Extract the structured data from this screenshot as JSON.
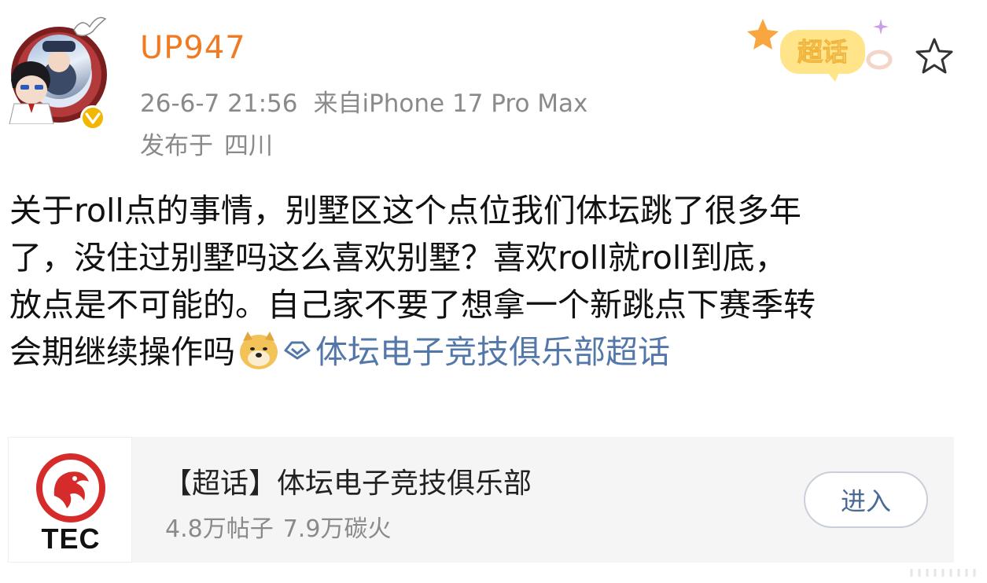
{
  "post": {
    "username": "UP947",
    "timestamp": "26-6-7 21:56",
    "source": "来自iPhone 17 Pro Max",
    "location_prefix": "发布于",
    "location": "四川",
    "chaohua_badge": "超话",
    "content_lines": [
      "关于roll点的事情，别墅区这个点位我们体坛跳了很多年",
      "了，没住过别墅吗这么喜欢别墅？喜欢roll就roll到底，",
      "放点是不可能的。自己家不要了想拿一个新跳点下赛季转",
      "会期继续操作吗"
    ],
    "topic_link": "体坛电子竞技俱乐部超话"
  },
  "card": {
    "logo_text": "TEC",
    "title": "【超话】体坛电子竞技俱乐部",
    "posts_count": "4.8万帖子",
    "heat": "7.9万碳火",
    "enter_label": "进入"
  },
  "colors": {
    "username": "#f07b22",
    "meta": "#8a8a8a",
    "link": "#5277a8",
    "card_bg": "#f5f5f5",
    "logo_red": "#d62b2b"
  }
}
